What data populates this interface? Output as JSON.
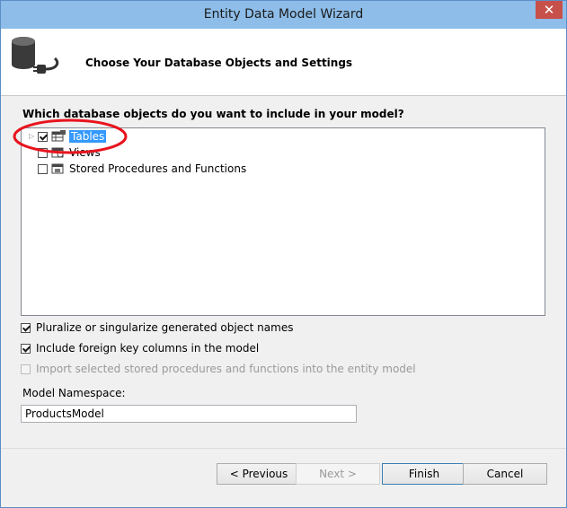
{
  "window": {
    "title": "Entity Data Model Wizard",
    "close_glyph": "✕"
  },
  "header": {
    "title": "Choose Your Database Objects and Settings",
    "icon": "database-plug-icon"
  },
  "objects": {
    "label": "Which database objects do you want to include in your model?",
    "items": [
      {
        "label": "Tables",
        "checked": true,
        "selected": true
      },
      {
        "label": "Views",
        "checked": false
      },
      {
        "label": "Stored Procedures and Functions",
        "checked": false
      }
    ]
  },
  "options": {
    "pluralize": "Pluralize or singularize generated object names",
    "foreign_keys": "Include foreign key columns in the model",
    "import_sprocs": "Import selected stored procedures and functions into the entity model"
  },
  "namespace": {
    "label": "Model Namespace:",
    "value": "ProductsModel"
  },
  "buttons": {
    "previous": "< Previous",
    "next": "Next >",
    "finish": "Finish",
    "cancel": "Cancel"
  },
  "colors": {
    "titlebar": "#8dbde8",
    "close": "#c7504a",
    "selection": "#3399ff",
    "annotation": "#e8141e"
  }
}
